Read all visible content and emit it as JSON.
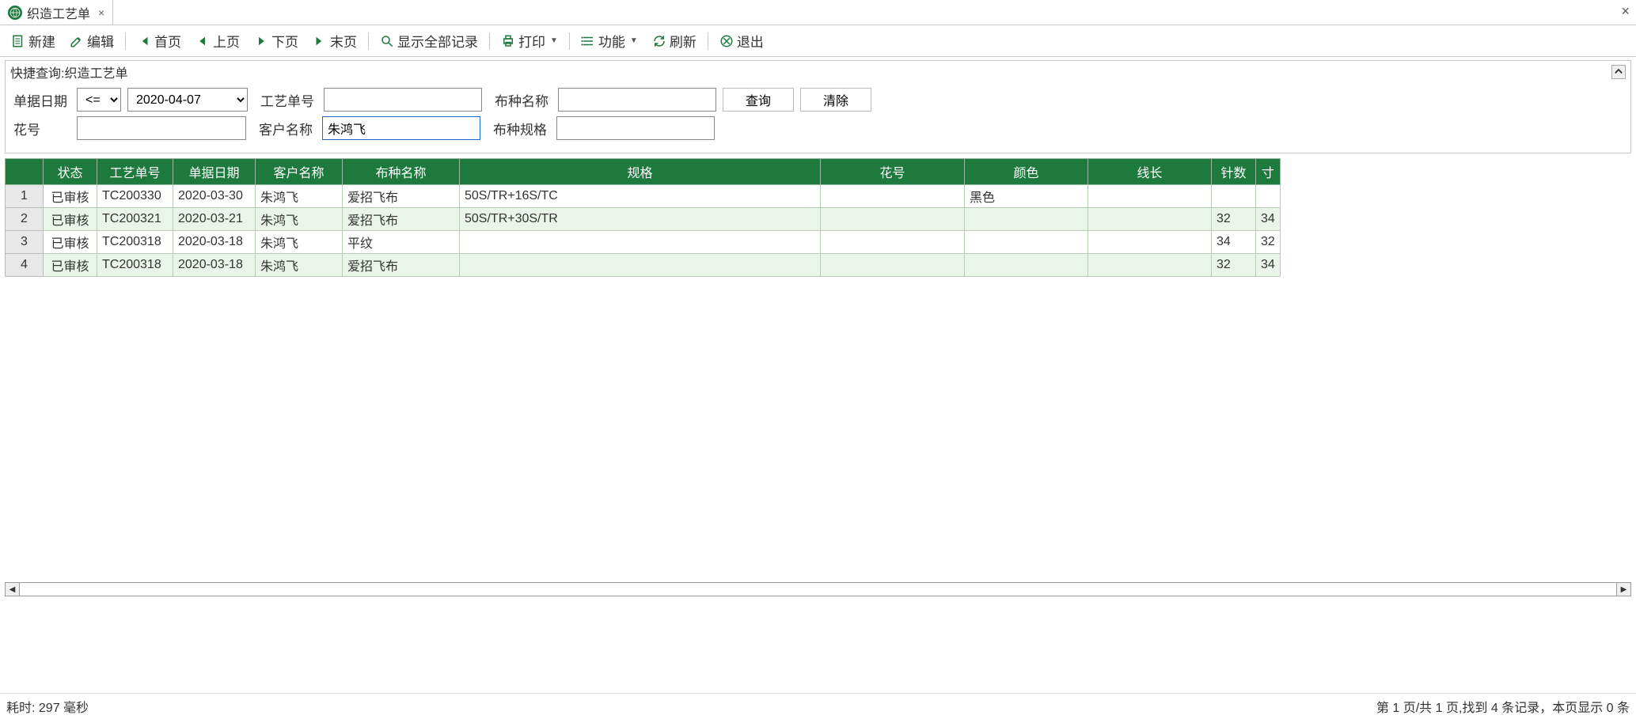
{
  "tab": {
    "title": "织造工艺单"
  },
  "toolbar": {
    "new": "新建",
    "edit": "编辑",
    "first": "首页",
    "prev": "上页",
    "next": "下页",
    "last": "末页",
    "show_all": "显示全部记录",
    "print": "打印",
    "function": "功能",
    "refresh": "刷新",
    "exit": "退出"
  },
  "query": {
    "title": "快捷查询:织造工艺单",
    "labels": {
      "doc_date": "单据日期",
      "doc_no": "工艺单号",
      "fabric_name": "布种名称",
      "flower_no": "花号",
      "customer": "客户名称",
      "fabric_spec": "布种规格"
    },
    "op_value": "<=",
    "date_value": "2020-04-07",
    "doc_no_value": "",
    "fabric_name_value": "",
    "flower_no_value": "",
    "customer_value": "朱鸿飞",
    "fabric_spec_value": "",
    "btn_query": "查询",
    "btn_clear": "清除"
  },
  "grid": {
    "headers": {
      "status": "状态",
      "doc_no": "工艺单号",
      "doc_date": "单据日期",
      "customer": "客户名称",
      "fabric_name": "布种名称",
      "spec": "规格",
      "flower_no": "花号",
      "color": "颜色",
      "line_len": "线长",
      "needle": "针数",
      "inch": "寸"
    },
    "rows": [
      {
        "n": "1",
        "status": "已审核",
        "doc_no": "TC200330",
        "date": "2020-03-30",
        "cust": "朱鸿飞",
        "fabric": "爱招飞布",
        "spec": "50S/TR+16S/TC",
        "flower": "",
        "color": "黑色",
        "linelen": "",
        "needle": "",
        "inch": ""
      },
      {
        "n": "2",
        "status": "已审核",
        "doc_no": "TC200321",
        "date": "2020-03-21",
        "cust": "朱鸿飞",
        "fabric": "爱招飞布",
        "spec": "50S/TR+30S/TR",
        "flower": "",
        "color": "",
        "linelen": "",
        "needle": "32",
        "inch": "34"
      },
      {
        "n": "3",
        "status": "已审核",
        "doc_no": "TC200318",
        "date": "2020-03-18",
        "cust": "朱鸿飞",
        "fabric": "平纹",
        "spec": "",
        "flower": "",
        "color": "",
        "linelen": "",
        "needle": "34",
        "inch": "32"
      },
      {
        "n": "4",
        "status": "已审核",
        "doc_no": "TC200318",
        "date": "2020-03-18",
        "cust": "朱鸿飞",
        "fabric": "爱招飞布",
        "spec": "",
        "flower": "",
        "color": "",
        "linelen": "",
        "needle": "32",
        "inch": "34"
      }
    ]
  },
  "status": {
    "left": "耗时: 297 毫秒",
    "right": "第 1 页/共 1 页,找到 4 条记录，本页显示 0 条"
  }
}
